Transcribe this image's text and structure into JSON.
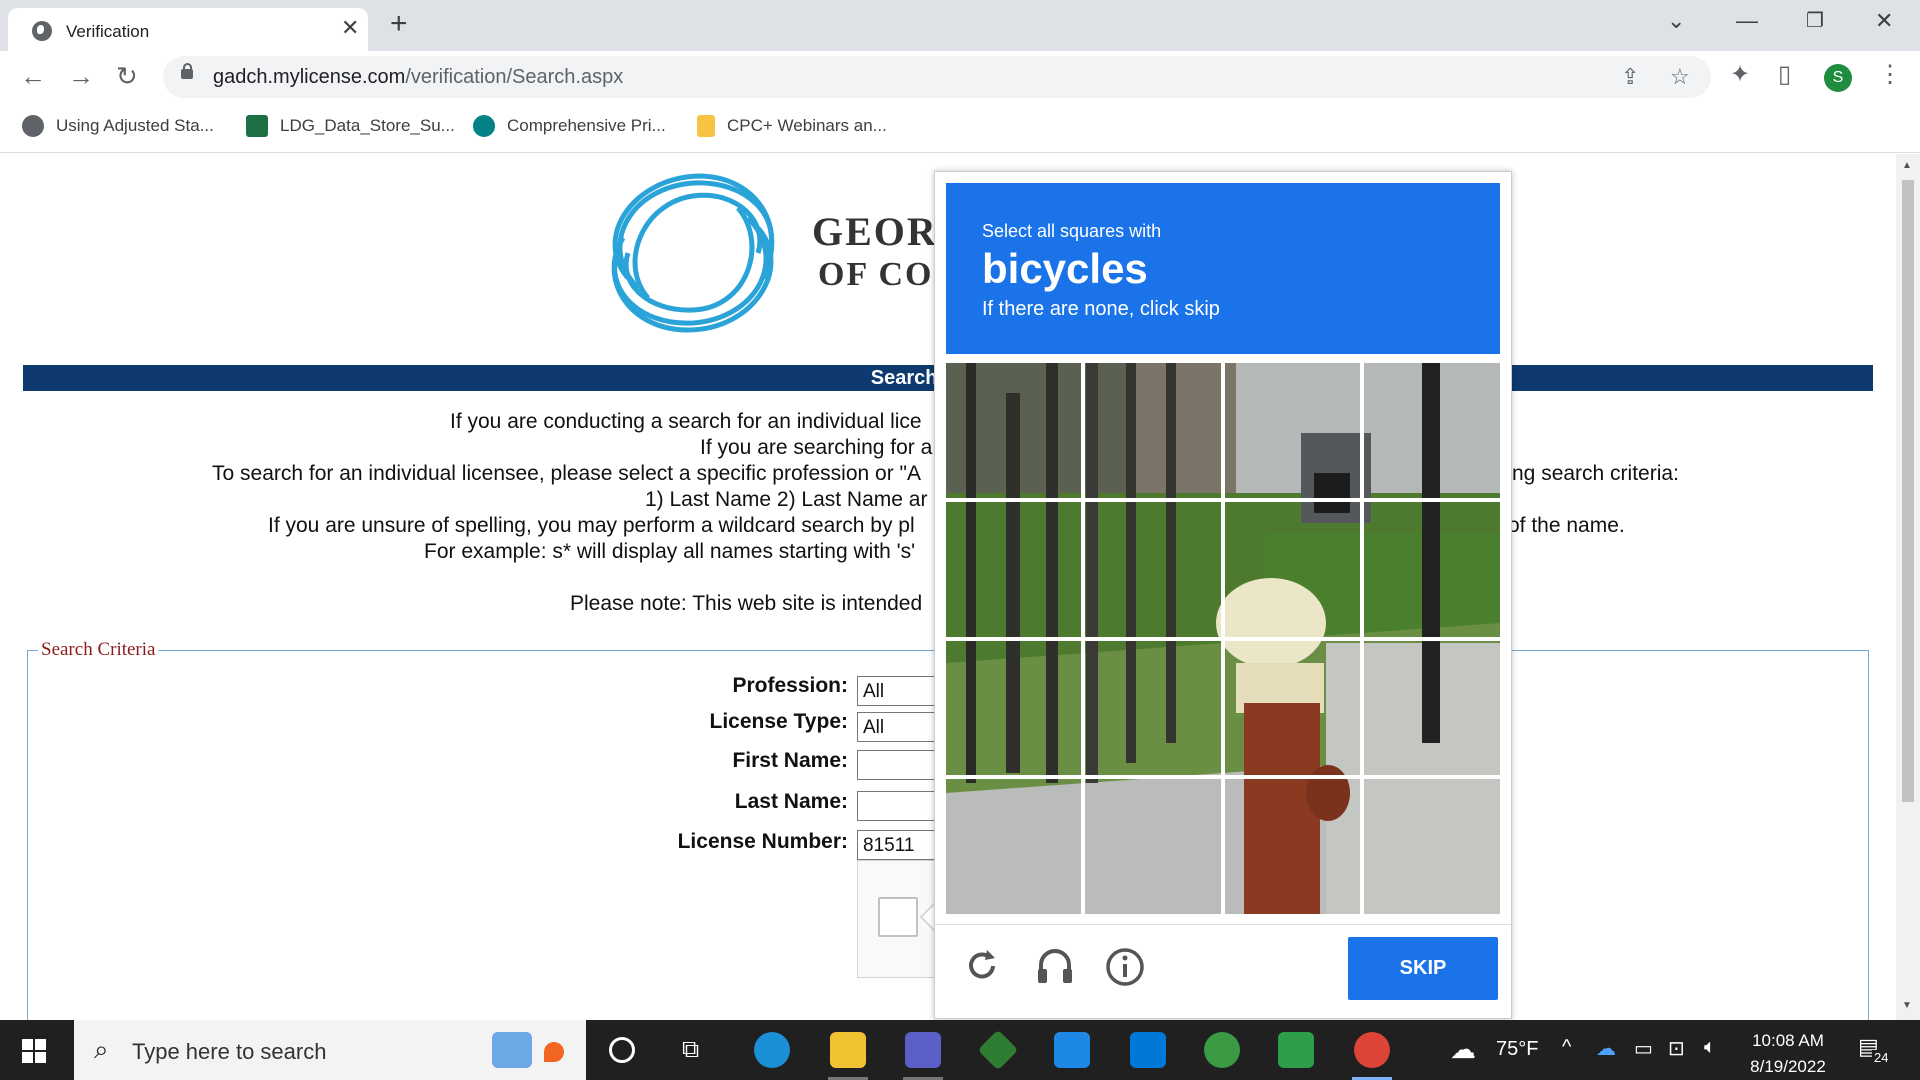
{
  "browser": {
    "tab_title": "Verification",
    "new_tab": "+",
    "tab_close": "✕",
    "url_host": "gadch.mylicense.com",
    "url_path": "/verification/Search.aspx",
    "profile_initial": "S",
    "bookmarks": [
      {
        "label": "Using Adjusted Sta...",
        "icon": "globe-icon",
        "color": "#5f6368"
      },
      {
        "label": "LDG_Data_Store_Su...",
        "icon": "excel-icon",
        "color": "#1d7044"
      },
      {
        "label": "Comprehensive Pri...",
        "icon": "sharepoint-icon",
        "color": "#038387"
      },
      {
        "label": "CPC+ Webinars an...",
        "icon": "folder-icon",
        "color": "#f6c343"
      }
    ]
  },
  "page": {
    "brand_line1": "GEORG",
    "brand_line2": "OF CO",
    "banner_title": "Search for a Pro",
    "paragraphs": [
      "If you are conducting a search for an individual lice",
      "If you are searching for a",
      "To search for an individual licensee, please select a specific profession or \"A",
      "ng search criteria:",
      "1) Last Name 2) Last Name ar",
      "If you are unsure of spelling, you may perform a wildcard search by pl",
      "of the name.",
      "For example: s* will display all names starting with 's'",
      "Please note: This web site is intended"
    ],
    "search_criteria_legend": "Search Criteria",
    "form": {
      "profession_label": "Profession:",
      "profession_value": "All",
      "license_type_label": "License Type:",
      "license_type_value": "All",
      "first_name_label": "First Name:",
      "first_name_value": "",
      "last_name_label": "Last Name:",
      "last_name_value": "",
      "license_number_label": "License Number:",
      "license_number_value": "81511"
    }
  },
  "captcha": {
    "instruction": "Select all squares with",
    "target": "bicycles",
    "hint": "If there are none, click skip",
    "skip_label": "SKIP",
    "grid_rows": 4,
    "grid_cols": 4,
    "header_color": "#1a73e8"
  },
  "taskbar": {
    "search_placeholder": "Type here to search",
    "weather": "75°F",
    "time": "10:08 AM",
    "date": "8/19/2022",
    "notification_count": "24"
  }
}
